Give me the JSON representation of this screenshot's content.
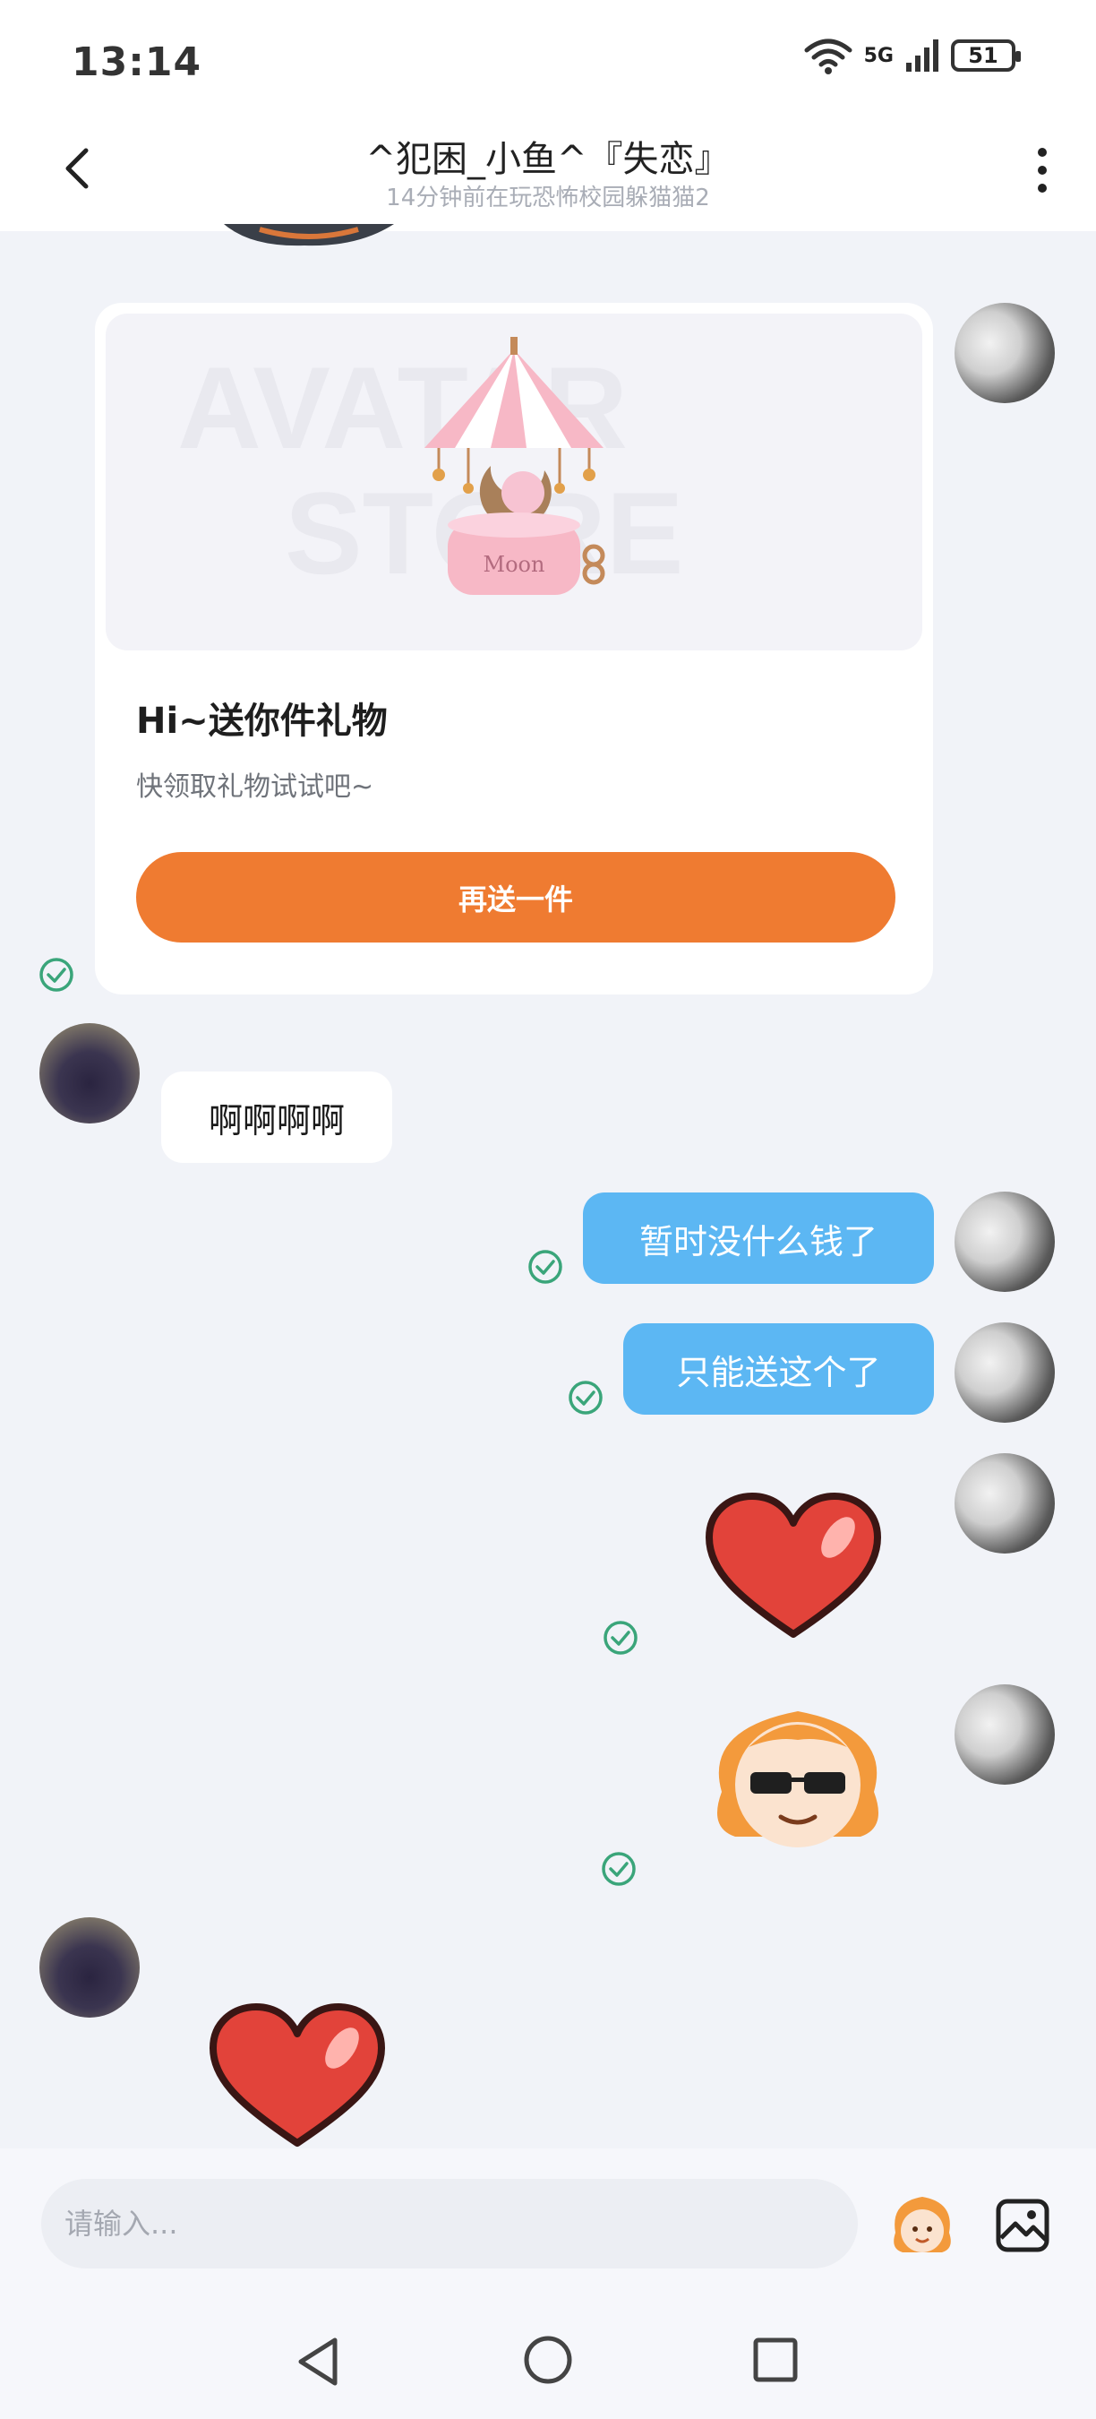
{
  "status_bar": {
    "time": "13:14",
    "network_label": "5G",
    "battery": "51",
    "icons": [
      "wifi-icon",
      "signal-icon",
      "battery-icon"
    ]
  },
  "header": {
    "title": "^犯困_小鱼^『失恋』",
    "subtitle": "14分钟前在玩恐怖校园躲猫猫2",
    "icons": [
      "back-arrow-icon",
      "more-vertical-icon"
    ]
  },
  "gift_card": {
    "title": "Hi~送你件礼物",
    "description": "快领取礼物试试吧~",
    "button_label": "再送一件",
    "image_caption": "Moon"
  },
  "messages": [
    {
      "sender": "other",
      "type": "text",
      "text": "啊啊啊啊"
    },
    {
      "sender": "self",
      "type": "text",
      "text": "暂时没什么钱了",
      "read": true
    },
    {
      "sender": "self",
      "type": "text",
      "text": "只能送这个了",
      "read": true
    },
    {
      "sender": "self",
      "type": "sticker",
      "sticker": "heart-sticker",
      "read": true
    },
    {
      "sender": "self",
      "type": "sticker",
      "sticker": "sunglasses-character-sticker",
      "read": true
    },
    {
      "sender": "other",
      "type": "sticker",
      "sticker": "heart-sticker"
    }
  ],
  "composer": {
    "placeholder": "请输入...",
    "icons": [
      "emoji-character-icon",
      "image-icon"
    ]
  },
  "nav": {
    "icons": [
      "nav-back-icon",
      "nav-home-icon",
      "nav-recents-icon"
    ]
  },
  "colors": {
    "accent": "#ef7b31",
    "outgoing_bubble": "#5cb7f3",
    "read_check": "#3aa57a",
    "background": "#f1f3f8"
  }
}
